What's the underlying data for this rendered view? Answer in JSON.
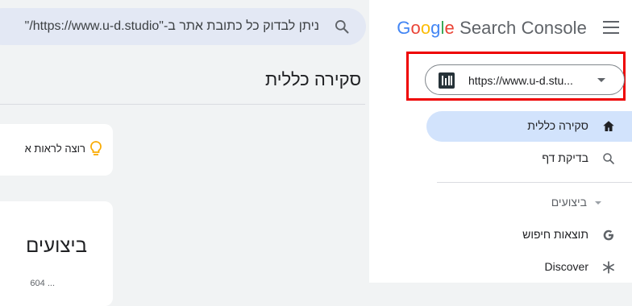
{
  "search": {
    "placeholder": "ניתן לבדוק כל כתובת אתר ב-\"https://www.u-d.studio/\""
  },
  "main": {
    "title": "סקירה כללית",
    "tip_text": "רוצה לראות א",
    "performance_title": "ביצועים",
    "performance_sub": "604 ..."
  },
  "sidebar": {
    "brand_google": [
      "G",
      "o",
      "o",
      "g",
      "l",
      "e"
    ],
    "brand_suffix": "Search Console",
    "property_url": "https://www.u-d.stu...",
    "nav": [
      {
        "label": "סקירה כללית",
        "icon": "home-icon",
        "active": true
      },
      {
        "label": "בדיקת דף",
        "icon": "search-icon",
        "active": false
      }
    ],
    "section_label": "ביצועים",
    "section_items": [
      {
        "label": "תוצאות חיפוש",
        "icon": "google-g-icon"
      },
      {
        "label": "Discover",
        "icon": "asterisk-icon"
      }
    ]
  },
  "colors": {
    "accent_active": "#d2e3fc",
    "highlight_red": "#e00"
  }
}
